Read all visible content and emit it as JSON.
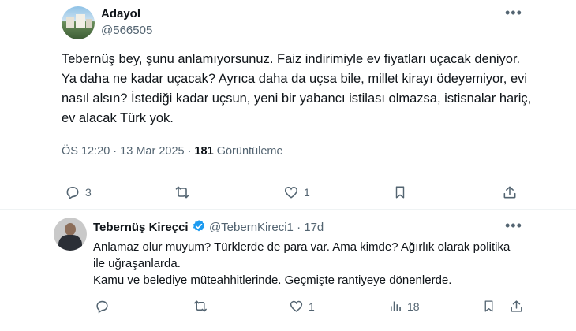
{
  "main_tweet": {
    "author_name": "Adayol",
    "author_handle": "@566505",
    "more_icon": "•••",
    "text": "Tebernüş bey, şunu anlamıyorsunuz. Faiz indirimiyle ev fiyatları uçacak deniyor. Ya daha ne kadar uçacak? Ayrıca daha da uçsa bile, millet kirayı ödeyemiyor, evi nasıl alsın? İstediği kadar uçsun, yeni bir yabancı istilası olmazsa, istisnalar hariç, ev alacak Türk yok.",
    "time": "ÖS 12:20",
    "separator": " · ",
    "date": "13 Mar 2025",
    "views_count": "181",
    "views_label": "Görüntüleme",
    "actions": {
      "reply_count": "3",
      "retweet_count": "",
      "like_count": "1"
    }
  },
  "reply": {
    "author_name": "Tebernüş Kireçci",
    "author_handle": "@TebernKireci1",
    "separator": " · ",
    "age": "17d",
    "more_icon": "•••",
    "line1": "Anlamaz olur muyum? Türklerde de para var. Ama kimde? Ağırlık olarak politika ile uğraşanlarda.",
    "line2": "Kamu ve belediye müteahhitlerinde. Geçmişte rantiyeye dönenlerde.",
    "actions": {
      "reply_count": "",
      "retweet_count": "",
      "like_count": "1",
      "views_count": "18"
    }
  },
  "colors": {
    "text": "#0f1419",
    "secondary": "#536471",
    "verified": "#1d9bf0",
    "divider": "#eff3f4"
  }
}
